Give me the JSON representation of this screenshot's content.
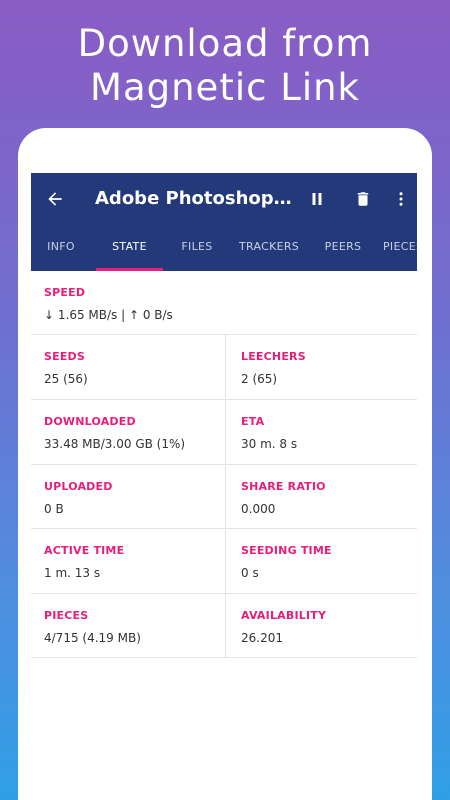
{
  "headline": [
    "Download from",
    "Magnetic Link"
  ],
  "toolbar": {
    "title": "Adobe Photoshop CC...",
    "back_icon": "arrow-left-icon",
    "pause_icon": "pause-icon",
    "delete_icon": "trash-icon",
    "more_icon": "more-vertical-icon"
  },
  "tabs": [
    "INFO",
    "STATE",
    "FILES",
    "TRACKERS",
    "PEERS",
    "PIECES"
  ],
  "active_tab": "STATE",
  "colors": {
    "appbar": "#23397a",
    "accent": "#e91e7a"
  },
  "state": {
    "speed": {
      "label": "SPEED",
      "value": "↓ 1.65 MB/s | ↑ 0 B/s"
    },
    "seeds": {
      "label": "SEEDS",
      "value": "25 (56)"
    },
    "leechers": {
      "label": "LEECHERS",
      "value": "2 (65)"
    },
    "downloaded": {
      "label": "DOWNLOADED",
      "value": "33.48 MB/3.00 GB (1%)"
    },
    "eta": {
      "label": "ETA",
      "value": "30 m. 8 s"
    },
    "uploaded": {
      "label": "UPLOADED",
      "value": "0 B"
    },
    "share_ratio": {
      "label": "SHARE RATIO",
      "value": "0.000"
    },
    "active_time": {
      "label": "ACTIVE TIME",
      "value": "1 m. 13 s"
    },
    "seeding_time": {
      "label": "SEEDING TIME",
      "value": "0 s"
    },
    "pieces": {
      "label": "PIECES",
      "value": "4/715 (4.19 MB)"
    },
    "availability": {
      "label": "AVAILABILITY",
      "value": "26.201"
    }
  }
}
